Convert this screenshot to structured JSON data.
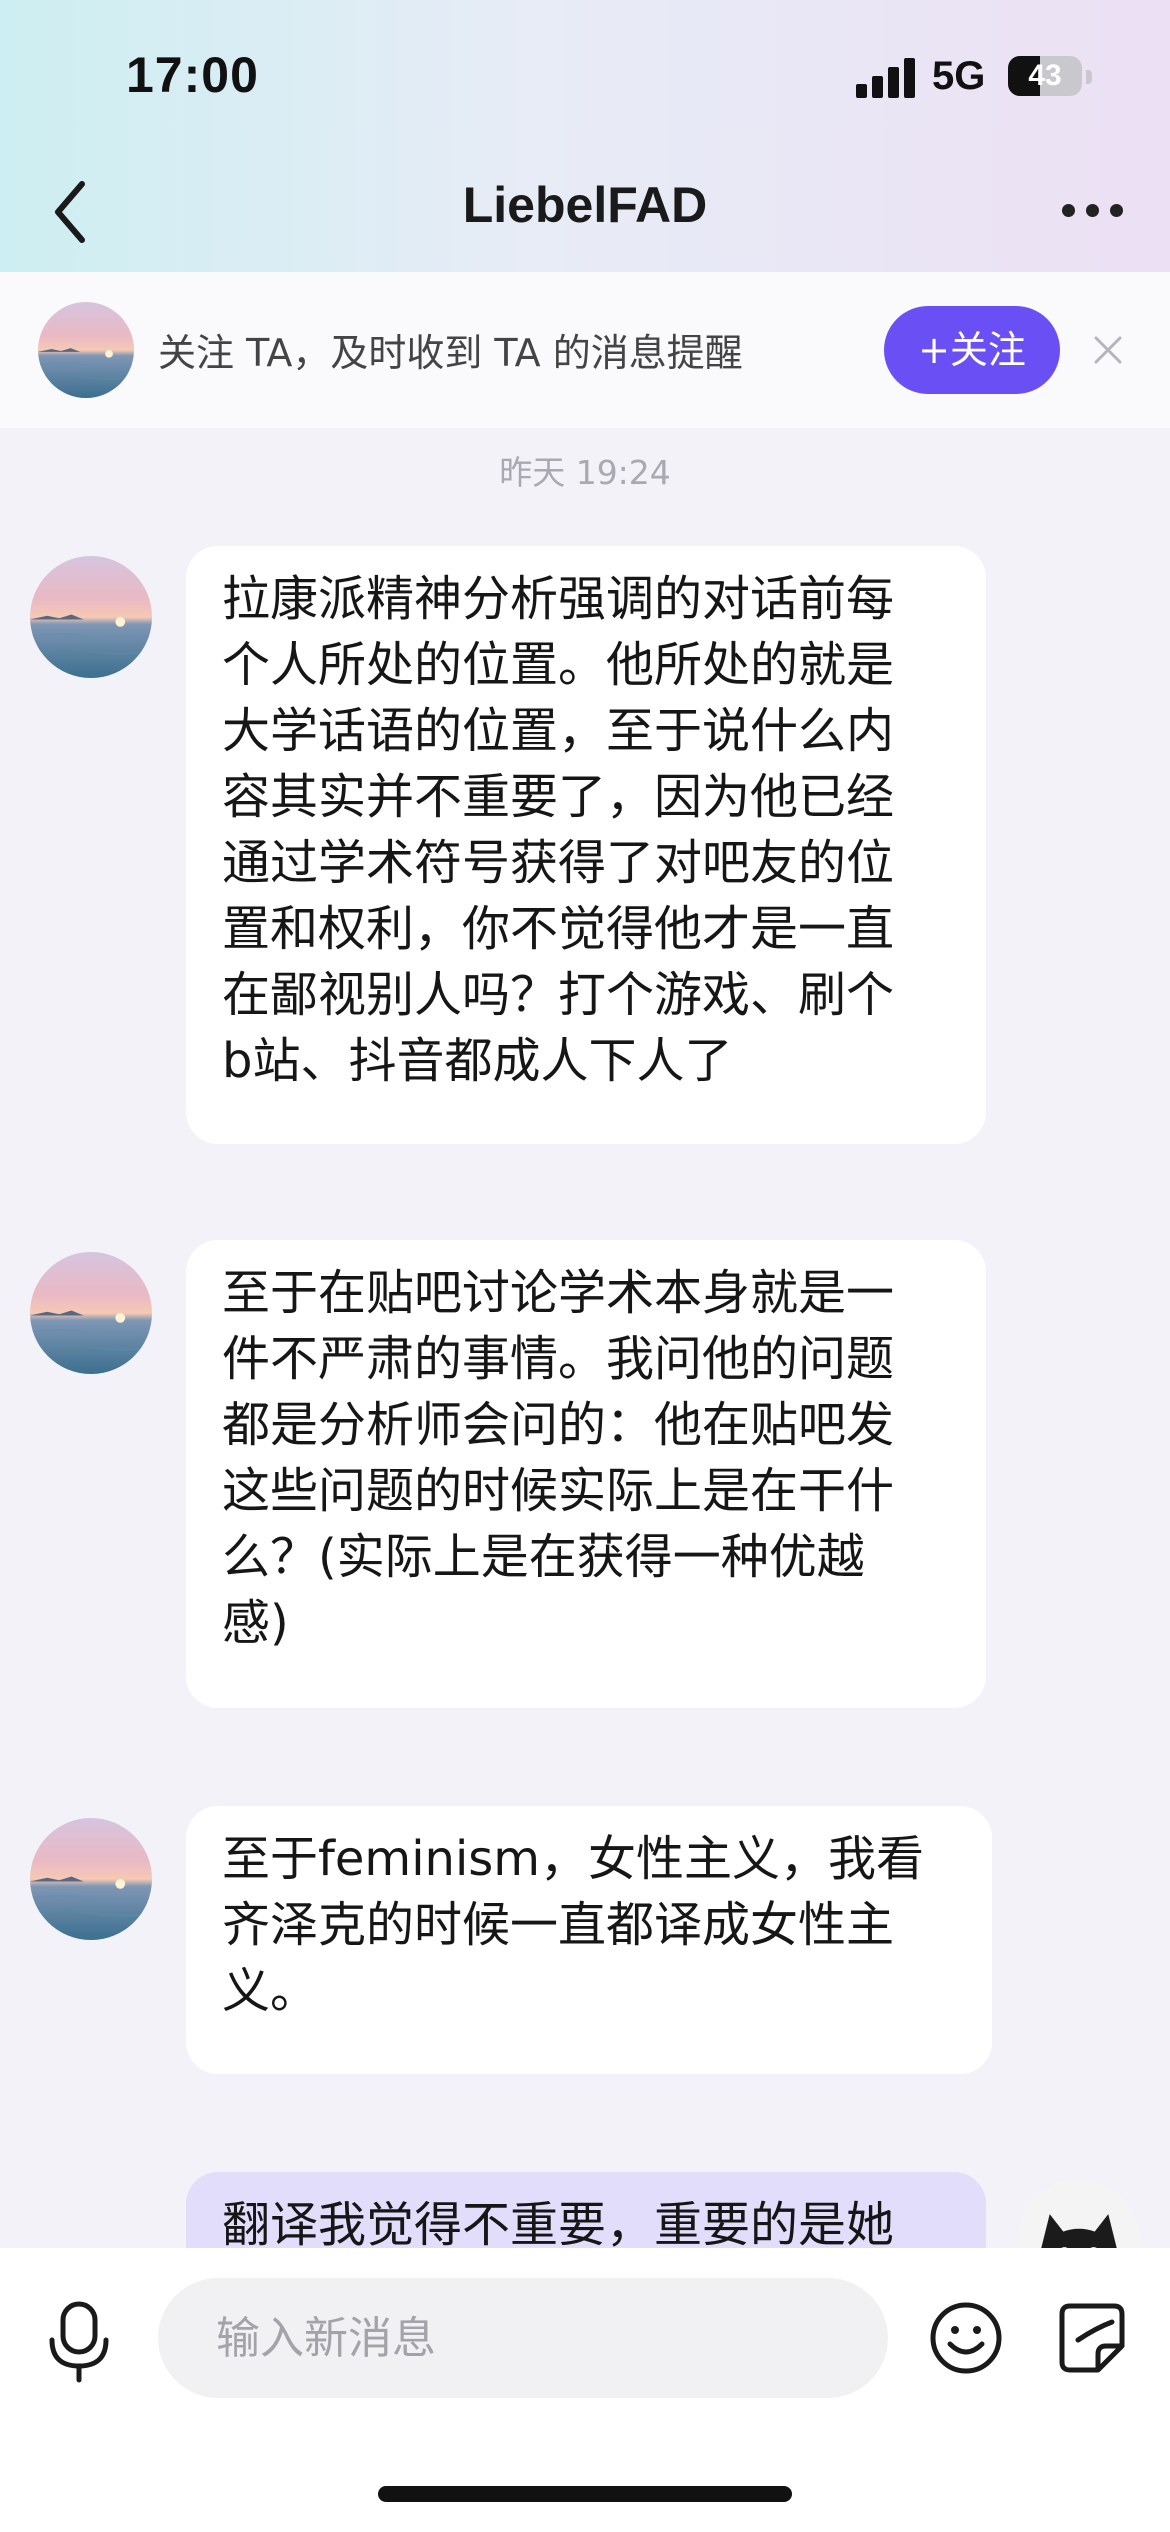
{
  "status_bar": {
    "time": "17:00",
    "network": "5G",
    "battery": "43",
    "battery_level": 0.43
  },
  "header": {
    "title": "LiebelFAD"
  },
  "follow_prompt": {
    "text": "关注 TA，及时收到 TA 的消息提醒",
    "button": "+关注"
  },
  "chat": {
    "timestamp": "昨天 19:24",
    "messages": [
      {
        "sender": "other",
        "lines": [
          "拉康派精神分析强调的对话前每",
          "个人所处的位置。他所处的就是",
          "大学话语的位置，至于说什么内",
          "容其实并不重要了，因为他已经",
          "通过学术符号获得了对吧友的位",
          "置和权利，你不觉得他才是一直",
          "在鄙视别人吗？打个游戏、刷个",
          "b站、抖音都成人下人了"
        ]
      },
      {
        "sender": "other",
        "lines": [
          "至于在贴吧讨论学术本身就是一",
          "件不严肃的事情。我问他的问题",
          "都是分析师会问的：他在贴吧发",
          "这些问题的时候实际上是在干什",
          "么？(实际上是在获得一种优越",
          "感)"
        ]
      },
      {
        "sender": "other",
        "lines": [
          "至于feminism，女性主义，我看",
          "齐泽克的时候一直都译成女性主",
          "义。"
        ]
      },
      {
        "sender": "self",
        "lines": [
          "翻译我觉得不重要，重要的是她"
        ]
      }
    ]
  },
  "input": {
    "placeholder": "输入新消息"
  },
  "icons": [
    "back-arrow-icon",
    "more-dots-icon",
    "close-icon",
    "microphone-icon",
    "emoji-icon",
    "sticker-icon"
  ],
  "colors": {
    "accent": "#6a4ff5",
    "self_bubble": "#e1ddfb",
    "background": "#f3f2f8"
  }
}
